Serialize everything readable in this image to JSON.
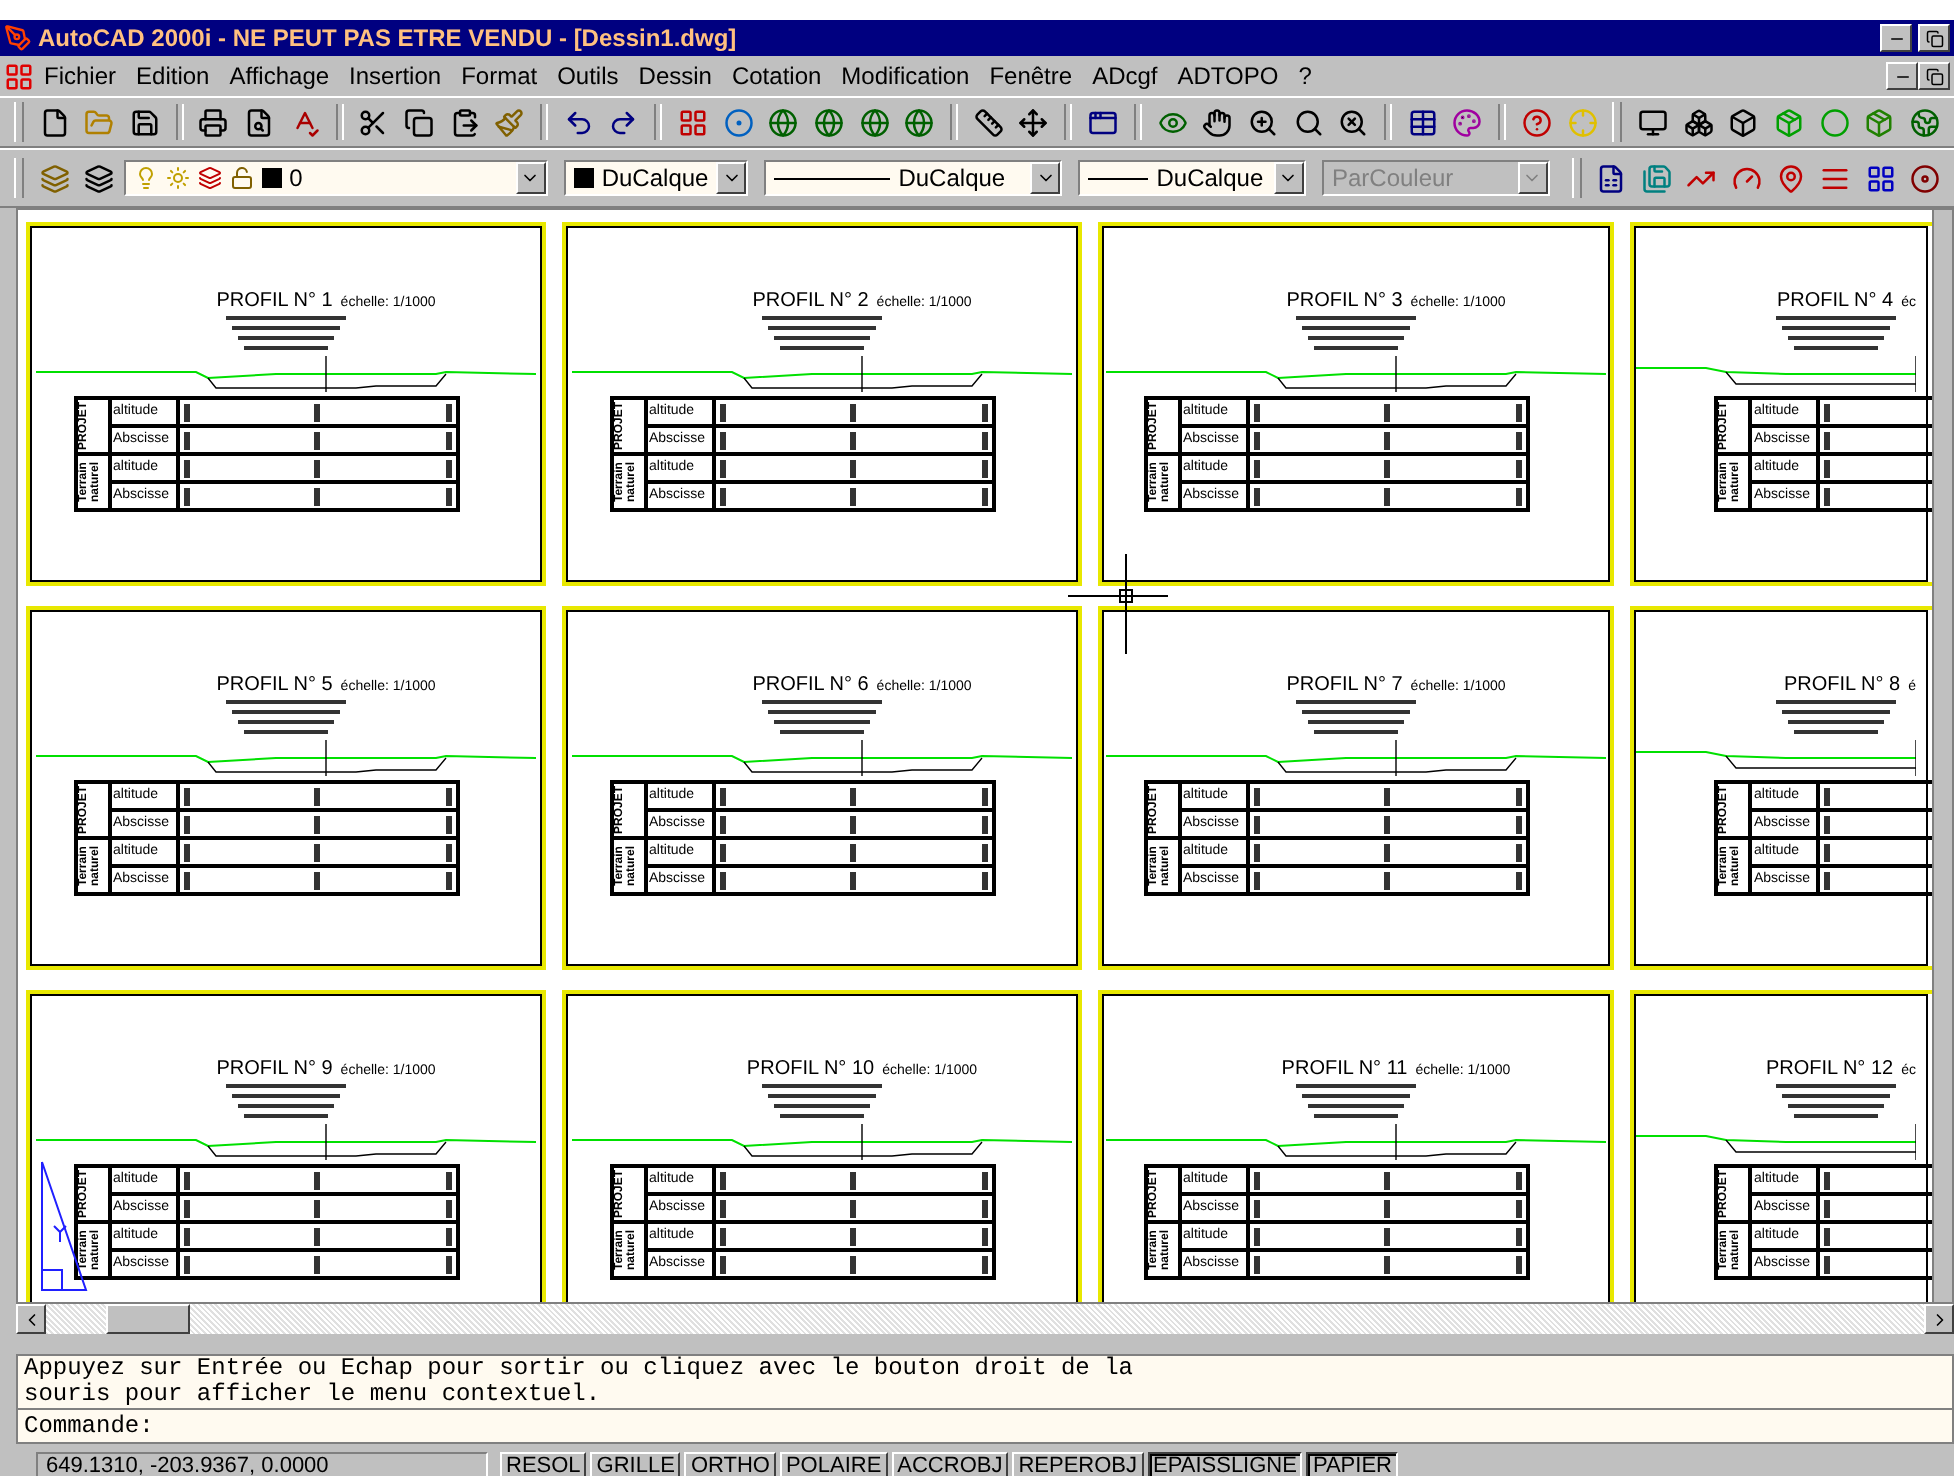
{
  "window": {
    "title": "AutoCAD 2000i - NE PEUT PAS ETRE VENDU - [Dessin1.dwg]"
  },
  "menu": [
    {
      "label": "Fichier"
    },
    {
      "label": "Edition"
    },
    {
      "label": "Affichage"
    },
    {
      "label": "Insertion"
    },
    {
      "label": "Format"
    },
    {
      "label": "Outils"
    },
    {
      "label": "Dessin"
    },
    {
      "label": "Cotation"
    },
    {
      "label": "Modification"
    },
    {
      "label": "Fenêtre"
    },
    {
      "label": "ADcgf"
    },
    {
      "label": "ADTOPO"
    },
    {
      "label": "?"
    }
  ],
  "properties_bar": [
    {
      "kind": "layer",
      "value": "0",
      "disabled": false
    },
    {
      "kind": "color",
      "value": "DuCalque",
      "disabled": false
    },
    {
      "kind": "linetype",
      "value": "DuCalque",
      "disabled": false
    },
    {
      "kind": "lineweight",
      "value": "DuCalque",
      "disabled": false
    },
    {
      "kind": "plotstyle",
      "value": "ParCouleur",
      "disabled": true
    }
  ],
  "sheets": [
    {
      "title": "PROFIL N° 1",
      "scale": "échelle: 1/1000",
      "table": [
        {
          "label": "PROJET",
          "rows": [
            "altitude",
            "Abscisse"
          ]
        },
        {
          "label": "Terrain naturel",
          "rows": [
            "altitude",
            "Abscisse"
          ]
        }
      ]
    },
    {
      "title": "PROFIL N° 2",
      "scale": "échelle: 1/1000",
      "table": [
        {
          "label": "PROJET",
          "rows": [
            "altitude",
            "Abscisse"
          ]
        },
        {
          "label": "Terrain naturel",
          "rows": [
            "altitude",
            "Abscisse"
          ]
        }
      ]
    },
    {
      "title": "PROFIL N° 3",
      "scale": "échelle: 1/1000",
      "table": [
        {
          "label": "PROJET",
          "rows": [
            "altitude",
            "Abscisse"
          ]
        },
        {
          "label": "Terrain naturel",
          "rows": [
            "altitude",
            "Abscisse"
          ]
        }
      ]
    },
    {
      "title": "PROFIL N° 4",
      "scale": "éc",
      "table": [
        {
          "label": "PROJET",
          "rows": [
            "altitude",
            "Abscisse"
          ]
        },
        {
          "label": "Terrain naturel",
          "rows": [
            "altitude",
            "Abscisse"
          ]
        }
      ]
    },
    {
      "title": "PROFIL N° 5",
      "scale": "échelle: 1/1000",
      "table": [
        {
          "label": "PROJET",
          "rows": [
            "altitude",
            "Abscisse"
          ]
        },
        {
          "label": "Terrain naturel",
          "rows": [
            "altitude",
            "Abscisse"
          ]
        }
      ]
    },
    {
      "title": "PROFIL N° 6",
      "scale": "échelle: 1/1000",
      "table": [
        {
          "label": "PROJET",
          "rows": [
            "altitude",
            "Abscisse"
          ]
        },
        {
          "label": "Terrain naturel",
          "rows": [
            "altitude",
            "Abscisse"
          ]
        }
      ]
    },
    {
      "title": "PROFIL N° 7",
      "scale": "échelle: 1/1000",
      "table": [
        {
          "label": "PROJET",
          "rows": [
            "altitude",
            "Abscisse"
          ]
        },
        {
          "label": "Terrain naturel",
          "rows": [
            "altitude",
            "Abscisse"
          ]
        }
      ]
    },
    {
      "title": "PROFIL N° 8",
      "scale": "é",
      "table": [
        {
          "label": "PROJET",
          "rows": [
            "altitude",
            "Abscisse"
          ]
        },
        {
          "label": "Terrain naturel",
          "rows": [
            "altitude",
            "Abscisse"
          ]
        }
      ]
    },
    {
      "title": "PROFIL N° 9",
      "scale": "échelle: 1/1000",
      "table": [
        {
          "label": "PROJET",
          "rows": [
            "altitude",
            "Abscisse"
          ]
        },
        {
          "label": "Terrain naturel",
          "rows": [
            "altitude",
            "Abscisse"
          ]
        }
      ]
    },
    {
      "title": "PROFIL N° 10",
      "scale": "échelle: 1/1000",
      "table": [
        {
          "label": "PROJET",
          "rows": [
            "altitude",
            "Abscisse"
          ]
        },
        {
          "label": "Terrain naturel",
          "rows": [
            "altitude",
            "Abscisse"
          ]
        }
      ]
    },
    {
      "title": "PROFIL N° 11",
      "scale": "échelle: 1/1000",
      "table": [
        {
          "label": "PROJET",
          "rows": [
            "altitude",
            "Abscisse"
          ]
        },
        {
          "label": "Terrain naturel",
          "rows": [
            "altitude",
            "Abscisse"
          ]
        }
      ]
    },
    {
      "title": "PROFIL N° 12",
      "scale": "éc",
      "table": [
        {
          "label": "PROJET",
          "rows": [
            "altitude",
            "Abscisse"
          ]
        },
        {
          "label": "Terrain naturel",
          "rows": [
            "altitude",
            "Abscisse"
          ]
        }
      ]
    }
  ],
  "command_history": [
    "Appuyez sur Entrée ou Echap pour sortir ou cliquez avec le bouton droit de la",
    "souris pour afficher le menu contextuel."
  ],
  "command_prompt": "Commande:",
  "status_bar": {
    "coordinates": "649.1310, -203.9367, 0.0000",
    "toggles": [
      {
        "label": "RESOL",
        "on": false
      },
      {
        "label": "GRILLE",
        "on": false
      },
      {
        "label": "ORTHO",
        "on": false
      },
      {
        "label": "POLAIRE",
        "on": false
      },
      {
        "label": "ACCROBJ",
        "on": false
      },
      {
        "label": "REPEROBJ",
        "on": false
      },
      {
        "label": "EPAISSLIGNE",
        "on": true
      },
      {
        "label": "PAPIER",
        "on": true
      }
    ]
  }
}
